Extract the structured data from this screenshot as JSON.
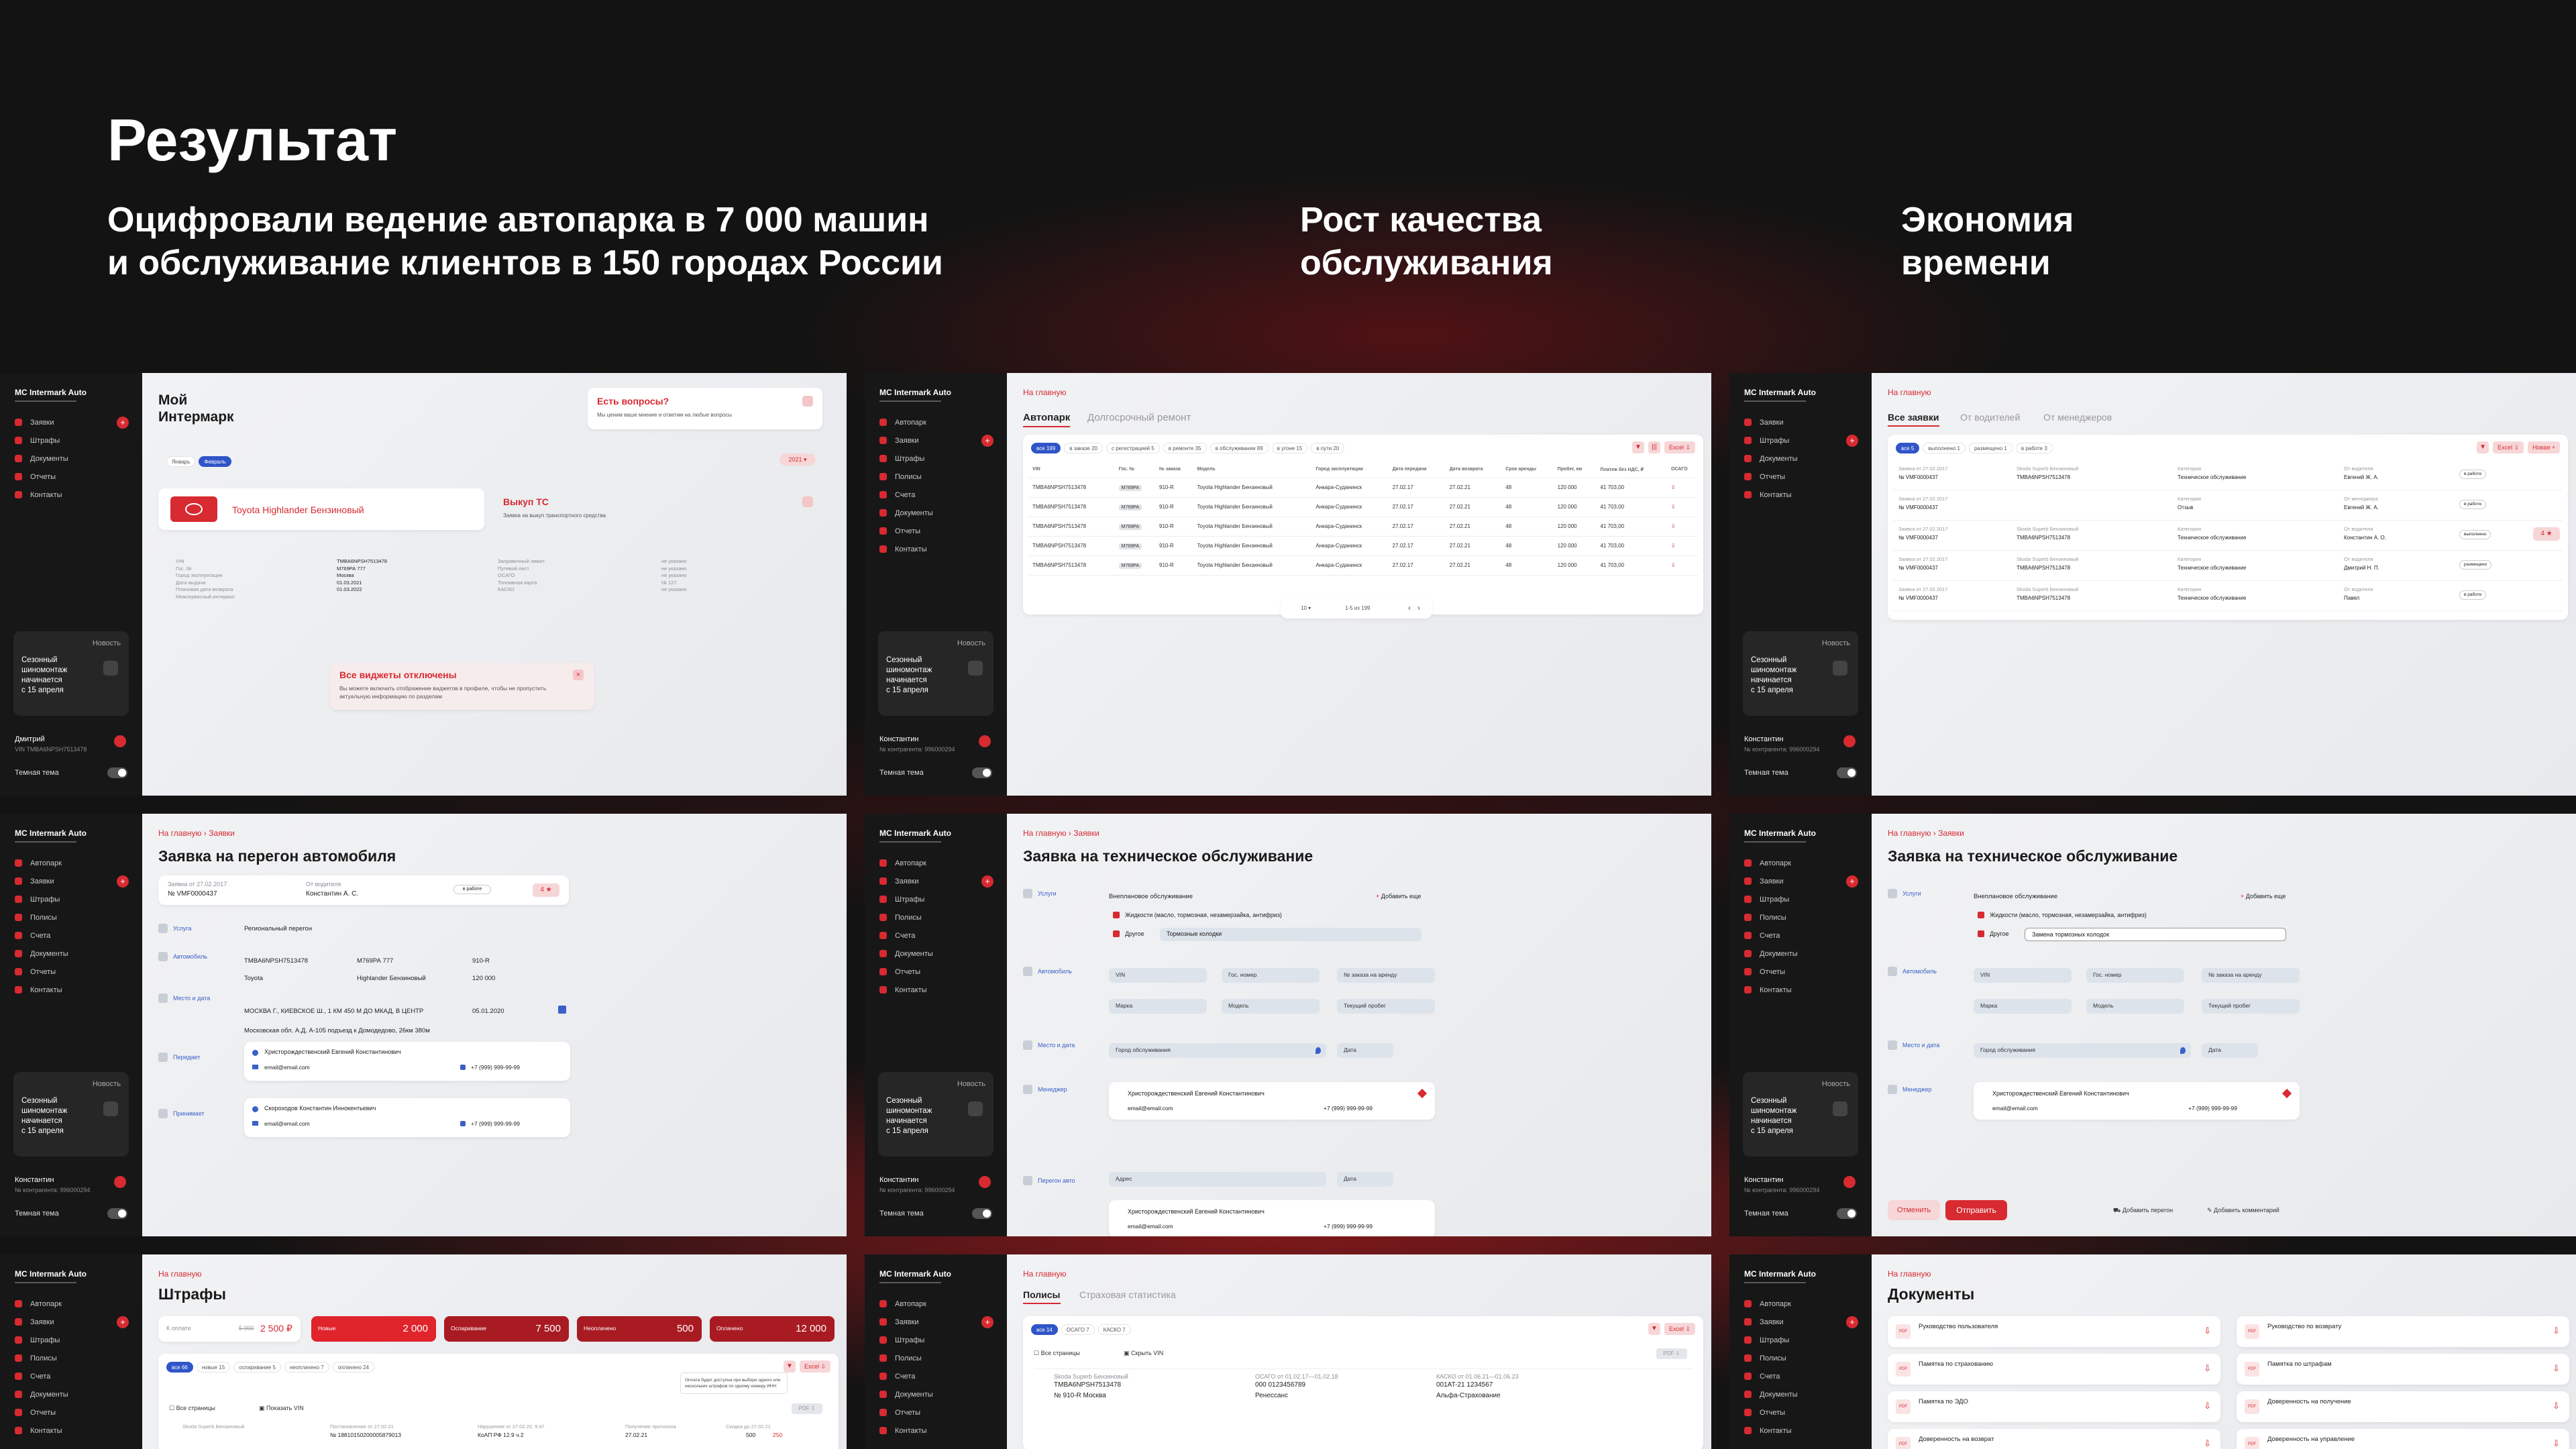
{
  "header": {
    "title": "Результат",
    "col1": "Оцифровали ведение автопарка в 7 000 машин\nи обслуживание клиентов в 150 городах России",
    "col2": "Рост качества\nобслуживания",
    "col3": "Экономия\nвремени"
  },
  "app": {
    "brand": "MC Intermark Auto",
    "dark_theme": "Темная тема",
    "promo_tag": "Новость",
    "promo_text": "Сезонный\nшиномонтаж\nначинается\nс 15 апреля"
  },
  "p1": {
    "nav": [
      "Заявки",
      "Штрафы",
      "Документы",
      "Отчеты",
      "Контакты"
    ],
    "title": "Мой\nИнтермарк",
    "question_title": "Есть вопросы?",
    "question_sub": "Мы ценим ваше мнение и ответим на любые вопросы",
    "chips": [
      "Январь",
      "Февраль"
    ],
    "year": "2021",
    "car": "Toyota Highlander Бензиновый",
    "buyout_title": "Выкуп ТС",
    "buyout_sub": "Заявка на выкуп транспортного средства",
    "fields": [
      [
        "VIN",
        "TMBA6NPSH7513478"
      ],
      [
        "Гос. №",
        "М769РА 777"
      ],
      [
        "Город эксплуатации",
        "Москва"
      ],
      [
        "Дата выдачи",
        "01.03.2021"
      ],
      [
        "Плановая дата возврата",
        "01.03.2022"
      ],
      [
        "Межсервисный интервал",
        ""
      ]
    ],
    "fields2": [
      [
        "Заправочный лимит",
        "не указано"
      ],
      [
        "Путевой лист",
        "не указано"
      ],
      [
        "ОСАГО",
        "не указано"
      ],
      [
        "Топливная карта",
        "№ 127"
      ],
      [
        "КАСКО",
        "не указано"
      ]
    ],
    "widgets_title": "Все виджеты отключены",
    "widgets_sub": "Вы можете включить отображение виджетов в профиле, чтобы не пропустить актуальную информацию по разделам",
    "user": "Дмитрий",
    "user_sub": "VIN TMBA6NPSH7513478"
  },
  "p2": {
    "nav": [
      "Автопарк",
      "Заявки",
      "Штрафы",
      "Полисы",
      "Счета",
      "Документы",
      "Отчеты",
      "Контакты"
    ],
    "crumb": "На главную",
    "tabs": [
      "Автопарк",
      "Долгосрочный ремонт"
    ],
    "chips": [
      "все 199",
      "в заказе 20",
      "с регистрацией 5",
      "в ремонте 35",
      "в обслуживании 89",
      "в угоне 15",
      "в пути 20"
    ],
    "cols": [
      "VIN",
      "Гос. №",
      "№ заказа",
      "Модель",
      "Город эксплуатации",
      "Дата передачи",
      "Дата возврата",
      "Срок аренды",
      "Пробег, км",
      "Платеж без НДС, ₽",
      "ОСАГО"
    ],
    "rows": [
      [
        "TMBA6NPSH7513478",
        "М769РА",
        "910-R",
        "Toyota Highlander Бензиновый",
        "Анкара-Суданинск",
        "27.02.17",
        "27.02.21",
        "48",
        "120 000",
        "41 703,00"
      ],
      [
        "TMBA6NPSH7513478",
        "М769РА",
        "910-R",
        "Toyota Highlander Бензиновый",
        "Анкара-Суданинск",
        "27.02.17",
        "27.02.21",
        "48",
        "120 000",
        "41 703,00"
      ],
      [
        "TMBA6NPSH7513478",
        "М769РА",
        "910-R",
        "Toyota Highlander Бензиновый",
        "Анкара-Суданинск",
        "27.02.17",
        "27.02.21",
        "48",
        "120 000",
        "41 703,00"
      ],
      [
        "TMBA6NPSH7513478",
        "М769РА",
        "910-R",
        "Toyota Highlander Бензиновый",
        "Анкара-Суданинск",
        "27.02.17",
        "27.02.21",
        "48",
        "120 000",
        "41 703,00"
      ],
      [
        "TMBA6NPSH7513478",
        "М769РА",
        "910-R",
        "Toyota Highlander Бензиновый",
        "Анкара-Суданинск",
        "27.02.17",
        "27.02.21",
        "48",
        "120 000",
        "41 703,00"
      ]
    ],
    "pager": "1-5 из 199",
    "user": "Константин",
    "user_sub": "№ контрагента: 996000294"
  },
  "p3": {
    "tabs": [
      "Все заявки",
      "От водителей",
      "От менеджеров"
    ],
    "chips": [
      "все 5",
      "выполнено 1",
      "размещено 1",
      "в работе 3"
    ],
    "new_btn": "Новая +",
    "rows": [
      [
        "Заявка от 27.02.2017",
        "№ VMF0000437",
        "Skoda Superb Бензиновый",
        "TMBA6NPSH7513478",
        "Категория",
        "Техническое обслуживание",
        "От водителя",
        "Евгений Ж. А.",
        "в работе"
      ],
      [
        "Заявка от 27.02.2017",
        "№ VMF0000437",
        "",
        "",
        "Категория",
        "Отзыв",
        "От менеджера",
        "Евгений Ж. А.",
        "в работе"
      ],
      [
        "Заявка от 27.02.2017",
        "№ VMF0000437",
        "Skoda Superb Бензиновый",
        "TMBA6NPSH7513478",
        "Категория",
        "Техническое обслуживание",
        "От водителя",
        "Константин А. О.",
        "выполнено"
      ],
      [
        "Заявка от 27.02.2017",
        "№ VMF0000437",
        "Skoda Superb Бензиновый",
        "TMBA6NPSH7513478",
        "Категория",
        "Техническое обслуживание",
        "От водителя",
        "Дмитрий Н. П.",
        "размещено"
      ],
      [
        "Заявка от 27.02.2017",
        "№ VMF0000437",
        "Skoda Superb Бензиновый",
        "TMBA6NPSH7513478",
        "Категория",
        "Техническое обслуживание",
        "От водителя",
        "Павел",
        "в работе"
      ]
    ]
  },
  "p4": {
    "crumbs": [
      "На главную",
      "Заявки"
    ],
    "title": "Заявка на перегон автомобиля",
    "req": "№ VMF0000437",
    "req_date": "Заявка от 27.02.2017",
    "from_label": "От водителя",
    "from": "Константин А. С.",
    "sections": [
      "Услуга",
      "Автомобиль",
      "Место и дата",
      "Передает",
      "Принимает"
    ],
    "service": "Региональный перегон",
    "vin": "TMBA6NPSH7513478",
    "plate": "М769РА 777",
    "order": "910-R",
    "make": "Toyota",
    "model": "Highlander Бензиновый",
    "mileage": "120 000",
    "place": "МОСКВА Г., КИЕВСКОЕ Ш., 1 КМ 450 М ДО МКАД, В ЦЕНТР",
    "date": "05.01.2020",
    "place2": "Московская обл. А.Д. А-105 подъезд к Домодедово, 26км 380м",
    "person1": "Христорождественский Евгений Константинович",
    "person2": "Скороходов Константин Иннокентьевич",
    "email": "email@email.com",
    "phone": "+7 (999) 999-99-99"
  },
  "p5": {
    "title": "Заявка на техническое обслуживание",
    "service": "Внеплановое обслуживание",
    "add_more": "Добавить еще",
    "check1": "Жидкости (масло, тормозная, незамерзайка, антифриз)",
    "check2": "Другое",
    "other": "Тормозные колодки",
    "fields": [
      "VIN",
      "Гос. номер",
      "№ заказа на аренду",
      "Марка",
      "Модель",
      "Текущий пробег"
    ],
    "city": "Город обслуживания",
    "date": "Дата",
    "sections": [
      "Услуги",
      "Автомобиль",
      "Место и дата",
      "Менеджер",
      "Перегон авто"
    ],
    "manager": "Христорождественский Евгений Константинович",
    "address": "Адрес"
  },
  "p6": {
    "other": "Замена тормозных колодок",
    "cancel": "Отменить",
    "send": "Отправить",
    "add_transfer": "Добавить перегон",
    "add_comment": "Добавить комментарий"
  },
  "p7": {
    "title": "Штрафы",
    "pay_label": "К оплате",
    "old": "5 000",
    "sum": "2 500 ₽",
    "cards": [
      [
        "Новые",
        "2 000"
      ],
      [
        "Оспаривание",
        "7 500"
      ],
      [
        "Неоплачено",
        "500"
      ],
      [
        "Оплачено",
        "12 000"
      ]
    ],
    "chips": [
      "все 66",
      "новые 15",
      "оспаривание 5",
      "неоплачено 7",
      "оплачено 24"
    ],
    "all_pages": "Все страницы",
    "show_vin": "Показать VIN",
    "tooltip": "Оплата будет доступна при выборе одного или нескольких штрафов по одному номеру ИНН",
    "row": [
      "Skoda Superb Бензиновый",
      "Постановление от 27.02.21",
      "Нарушение от 27.02.20, 9:47",
      "Получение протокола",
      "Скидка до 27.02.21"
    ],
    "row2": [
      "№ 18810150200005879013",
      "КоАП РФ 12.9 ч.2",
      "27.02.21",
      "500",
      "250"
    ]
  },
  "p8": {
    "tabs": [
      "Полисы",
      "Страховая статистика"
    ],
    "chips": [
      "все 14",
      "ОСАГО 7",
      "КАСКО 7"
    ],
    "all_pages": "Все страницы",
    "hide_vin": "Скрыть VIN",
    "car": "Skoda Superb Бензиновый",
    "vin": "TMBA6NPSH7513478",
    "plate": "№ 910-R Москва",
    "osago": "ОСАГО от 01.02.17—01.02.18",
    "osago_no": "000 0123456789",
    "osago_co": "Ренессанс",
    "kasko": "КАСКО от 01.06.21—01.06.23",
    "kasko_no": "001AT-21 1234567",
    "kasko_co": "Альфа-Страхование"
  },
  "p9": {
    "title": "Документы",
    "left": [
      "Руководство пользователя",
      "Памятка по страхованию",
      "Памятка по ЭДО",
      "Доверенность на возврат"
    ],
    "right": [
      "Руководство по возврату",
      "Памятка по штрафам",
      "Доверенность на получение",
      "Доверенность на управление"
    ]
  },
  "actions": {
    "excel": "Excel"
  }
}
